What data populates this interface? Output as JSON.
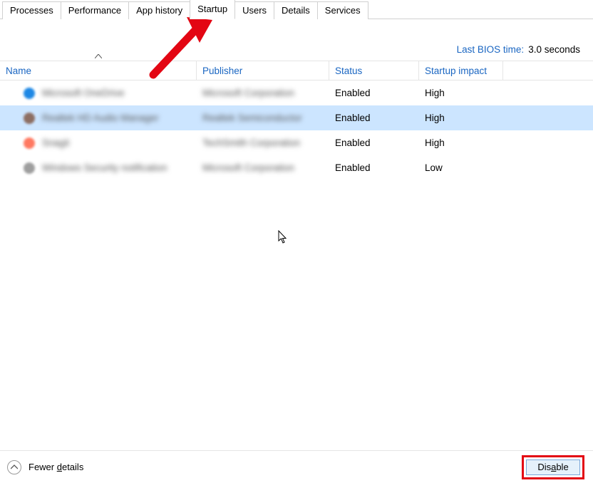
{
  "tabs": [
    {
      "label": "Processes",
      "active": false
    },
    {
      "label": "Performance",
      "active": false
    },
    {
      "label": "App history",
      "active": false
    },
    {
      "label": "Startup",
      "active": true
    },
    {
      "label": "Users",
      "active": false
    },
    {
      "label": "Details",
      "active": false
    },
    {
      "label": "Services",
      "active": false
    }
  ],
  "bios": {
    "label": "Last BIOS time:",
    "value": "3.0 seconds"
  },
  "columns": {
    "name": "Name",
    "publisher": "Publisher",
    "status": "Status",
    "impact": "Startup impact",
    "sort_column": "name",
    "sort_dir": "asc"
  },
  "rows": [
    {
      "icon_color": "#1e88e5",
      "name_blur": "Microsoft OneDrive",
      "publisher_blur": "Microsoft Corporation",
      "status": "Enabled",
      "impact": "High",
      "selected": false
    },
    {
      "icon_color": "#8d6e63",
      "name_blur": "Realtek HD Audio Manager",
      "publisher_blur": "Realtek Semiconductor",
      "status": "Enabled",
      "impact": "High",
      "selected": true
    },
    {
      "icon_color": "#ff7961",
      "name_blur": "Snagit",
      "publisher_blur": "TechSmith Corporation",
      "status": "Enabled",
      "impact": "High",
      "selected": false
    },
    {
      "icon_color": "#9e9e9e",
      "name_blur": "Windows Security notification",
      "publisher_blur": "Microsoft Corporation",
      "status": "Enabled",
      "impact": "Low",
      "selected": false
    }
  ],
  "footer": {
    "fewer_prefix": "Fewer ",
    "fewer_ul": "d",
    "fewer_suffix": "etails",
    "disable_prefix": "Dis",
    "disable_ul": "a",
    "disable_suffix": "ble"
  },
  "annotations": {
    "arrow_points_to": "startup-tab",
    "highlight_box_on": "disable-button"
  }
}
